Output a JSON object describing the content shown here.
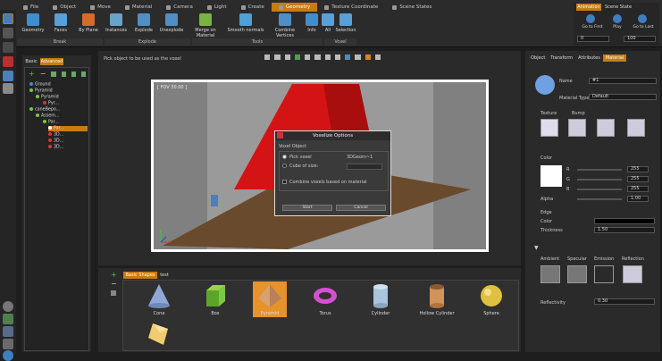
{
  "ribbon": {
    "tabs": [
      {
        "label": "File"
      },
      {
        "label": "Object"
      },
      {
        "label": "Move"
      },
      {
        "label": "Material"
      },
      {
        "label": "Camera"
      },
      {
        "label": "Light"
      },
      {
        "label": "Create"
      },
      {
        "label": "Geometry"
      },
      {
        "label": "Texture Coordinate"
      },
      {
        "label": "Scene States"
      }
    ],
    "buttons": [
      {
        "label": "Geometry"
      },
      {
        "label": "Faces"
      },
      {
        "label": "By Plane"
      },
      {
        "label": "Instances"
      },
      {
        "label": "Explode"
      },
      {
        "label": "Unexplode"
      },
      {
        "label": "Merge on Material"
      },
      {
        "label": "Smooth normals"
      },
      {
        "label": "Combine Vertices"
      },
      {
        "label": "Info"
      },
      {
        "label": "All"
      },
      {
        "label": "Selection"
      }
    ],
    "groups": [
      {
        "label": "Break"
      },
      {
        "label": "Explode"
      },
      {
        "label": "Tools"
      },
      {
        "label": "Voxel"
      }
    ]
  },
  "animation": {
    "tabs": [
      {
        "label": "Animation"
      },
      {
        "label": "Scene State"
      }
    ],
    "goto_first": "Go to First",
    "play": "Play",
    "goto_last": "Go to Last",
    "start_value": "0",
    "end_value": "100"
  },
  "scene_panel": {
    "tabs": [
      {
        "label": "Basic"
      },
      {
        "label": "Advanced"
      }
    ],
    "tree": [
      {
        "label": "Ground"
      },
      {
        "label": "Pyramid"
      },
      {
        "label": "Pyramid"
      },
      {
        "label": "Pyr..."
      },
      {
        "label": "caneBepo..."
      },
      {
        "label": "Assem..."
      },
      {
        "label": "Par..."
      },
      {
        "label": "Par..."
      },
      {
        "label": "3D..."
      },
      {
        "label": "3D..."
      },
      {
        "label": "3D..."
      }
    ]
  },
  "viewport": {
    "hint": "Pick object to be used as the voxel",
    "fov_label": "[ FOV 30.00 ]"
  },
  "dialog": {
    "title": "Voxelize Options",
    "group": "Voxel Object",
    "pick_voxel": "Pick voxel",
    "pick_value": "3DGeom~1",
    "cube_of_size": "Cube of size:",
    "combine": "Combine voxels based on material",
    "start": "Start",
    "cancel": "Cancel"
  },
  "shapes_panel": {
    "tabs": [
      {
        "label": "Basic Shapes"
      },
      {
        "label": "test"
      }
    ],
    "items": [
      {
        "label": "Cone"
      },
      {
        "label": "Box"
      },
      {
        "label": "Pyramid"
      },
      {
        "label": "Torus"
      },
      {
        "label": "Cylinder"
      },
      {
        "label": "Hollow Cylinder"
      },
      {
        "label": "Sphere"
      }
    ]
  },
  "material_panel": {
    "tabs": [
      {
        "label": "Object"
      },
      {
        "label": "Transform"
      },
      {
        "label": "Attributes"
      },
      {
        "label": "Material"
      }
    ],
    "name_label": "Name",
    "name_value": "#1",
    "type_label": "Material Type",
    "type_value": "Default",
    "texture": "Texture",
    "bump": "Bump",
    "color_section": "Color",
    "r": "R",
    "g": "G",
    "b": "B",
    "alpha": "Alpha",
    "r_val": "255",
    "g_val": "255",
    "b_val": "255",
    "alpha_val": "1.00",
    "edge_section": "Edge",
    "edge_color": "Color",
    "thickness": "Thickness",
    "thickness_val": "1.50",
    "ambient": "Ambient",
    "specular": "Specular",
    "emission": "Emission",
    "reflection": "Reflection",
    "reflectivity": "Reflectivity",
    "reflectivity_val": "0.30"
  },
  "colors": {
    "accent": "#c97b10",
    "pyramid": "#d41414",
    "floor": "#6a4a2c"
  }
}
